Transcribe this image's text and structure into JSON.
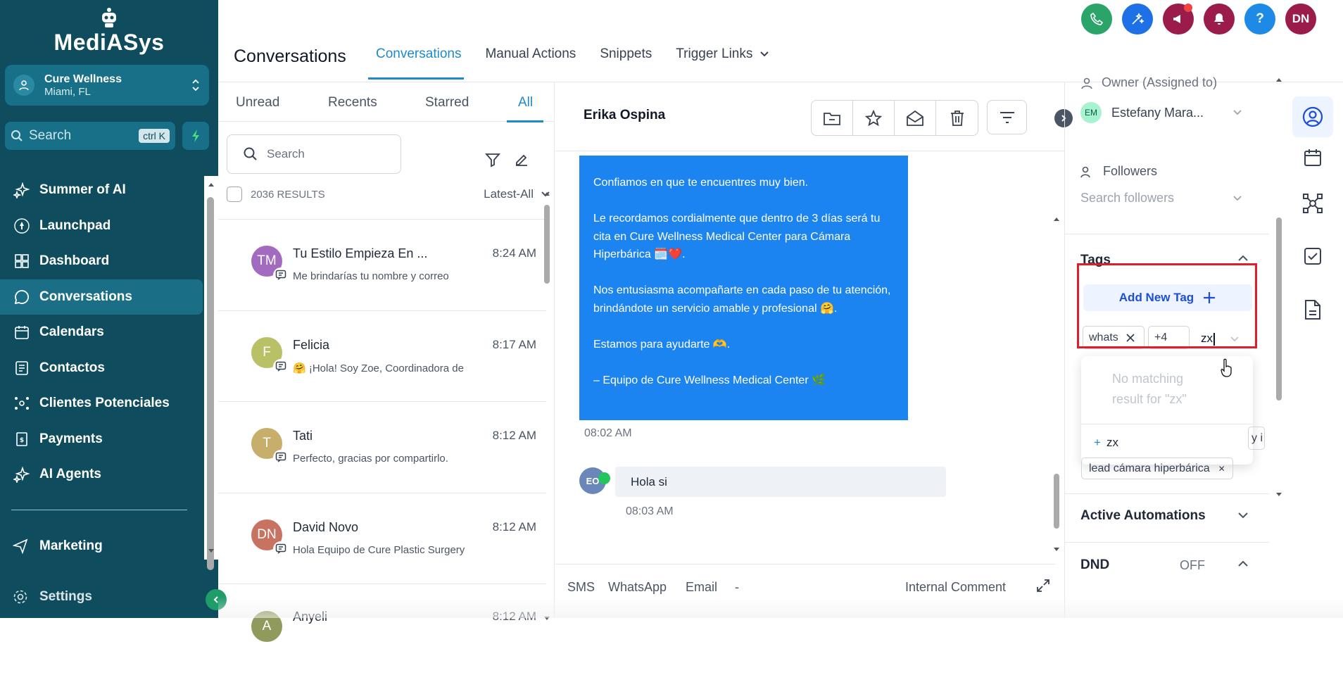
{
  "app": {
    "name": "MediASys"
  },
  "location": {
    "name": "Cure Wellness",
    "city": "Miami, FL"
  },
  "sidebar": {
    "search_placeholder": "Search",
    "search_shortcut": "ctrl K",
    "items": [
      {
        "label": "Summer of AI",
        "icon": "sparkle-icon"
      },
      {
        "label": "Launchpad",
        "icon": "rocket-icon"
      },
      {
        "label": "Dashboard",
        "icon": "dashboard-icon"
      },
      {
        "label": "Conversations",
        "icon": "chat-bubble-icon"
      },
      {
        "label": "Calendars",
        "icon": "calendar-icon"
      },
      {
        "label": "Contactos",
        "icon": "contacts-icon"
      },
      {
        "label": "Clientes Potenciales",
        "icon": "network-icon"
      },
      {
        "label": "Payments",
        "icon": "payments-icon"
      },
      {
        "label": "AI Agents",
        "icon": "sparkle-icon"
      }
    ],
    "active_item": "Conversations",
    "marketing_label": "Marketing",
    "settings_label": "Settings"
  },
  "header": {
    "title": "Conversations",
    "tabs": [
      "Conversations",
      "Manual Actions",
      "Snippets",
      "Trigger Links"
    ],
    "active_tab": "Conversations",
    "user_initials": "DN",
    "icon_colors": {
      "phone": "#2aa469",
      "magic": "#1d70e6",
      "announce": "#9b1b4a",
      "bell": "#9b1b4a",
      "help": "#1d8ae6",
      "avatar": "#9b1b4a"
    }
  },
  "list": {
    "filters": [
      "Unread",
      "Recents",
      "Starred",
      "All"
    ],
    "active_filter": "All",
    "search_placeholder": "Search",
    "results": "2036 RESULTS",
    "sort": "Latest-All",
    "conversations": [
      {
        "initials": "TM",
        "color": "#a36bbf",
        "name": "Tu Estilo Empieza En ...",
        "time": "8:24 AM",
        "snippet": "Me brindarías tu nombre y correo"
      },
      {
        "initials": "F",
        "color": "#b9c066",
        "name": "Felicia",
        "time": "8:17 AM",
        "snippet": "🤗 ¡Hola! Soy Zoe, Coordinadora de"
      },
      {
        "initials": "T",
        "color": "#c7ae6a",
        "name": "Tati",
        "time": "8:12 AM",
        "snippet": "Perfecto, gracias por compartirlo."
      },
      {
        "initials": "DN",
        "color": "#c87362",
        "name": "David Novo",
        "time": "8:12 AM",
        "snippet": "Hola Equipo de Cure Plastic Surgery"
      },
      {
        "initials": "A",
        "color": "#8f9a5c",
        "name": "Anyeli",
        "time": "8:12 AM",
        "snippet": ""
      }
    ]
  },
  "chat": {
    "contact_name": "Erika Ospina",
    "outgoing": {
      "lines": [
        "Confiamos en que te encuentres muy bien.",
        "Le recordamos cordialmente que dentro de 3 días será tu cita en Cure Wellness Medical Center para Cámara Hiperbárica 🗓️❤️.",
        "Nos entusiasma acompañarte en cada paso de tu atención, brindándote un servicio amable y profesional 🤗.",
        "Estamos para ayudarte 🫶.",
        "– Equipo de Cure Wellness Medical Center 🌿"
      ],
      "time": "08:02 AM"
    },
    "incoming": {
      "initials": "EO",
      "text": "Hola si",
      "time": "08:03 AM"
    },
    "composer_tabs": [
      "SMS",
      "WhatsApp",
      "Email",
      "-",
      "Internal Comment"
    ]
  },
  "panel": {
    "owner_label": "Owner (Assigned to)",
    "owner_initials": "EM",
    "owner_name": "Estefany Mara...",
    "followers_label": "Followers",
    "followers_placeholder": "Search followers",
    "tags_label": "Tags",
    "add_tag_label": "Add New Tag",
    "chips": [
      "whats",
      "+4"
    ],
    "tag_input": "zx",
    "dropdown": {
      "no_match_line1": "No matching",
      "no_match_line2": "result for \"zx\"",
      "create_option": "zx"
    },
    "partial_chip": "y i",
    "lead_tag": "lead cámara hiperbárica",
    "active_automations_label": "Active Automations",
    "dnd_label": "DND",
    "dnd_value": "OFF"
  },
  "rail": {
    "items": [
      "contact-icon",
      "calendar-icon",
      "network-icon",
      "checkbox-icon",
      "document-icon"
    ]
  }
}
